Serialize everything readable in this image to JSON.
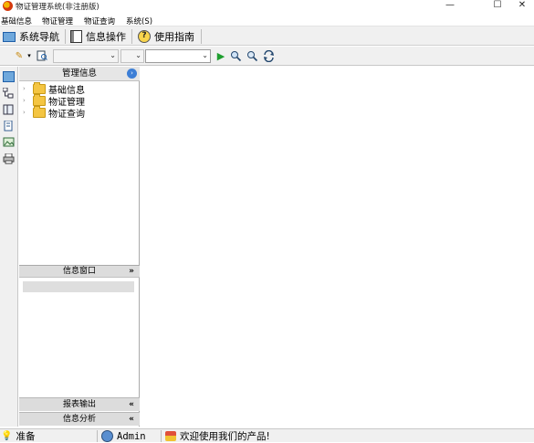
{
  "window": {
    "title": "物证管理系统(非注册版)",
    "controls": {
      "minimize": "—",
      "maximize": "☐",
      "close": "✕"
    }
  },
  "menu": [
    "基础信息",
    "物证管理",
    "物证查询",
    "系统(S)"
  ],
  "nav_toolbar": [
    {
      "label": "系统导航",
      "icon": "monitor-icon"
    },
    {
      "label": "信息操作",
      "icon": "book-icon"
    },
    {
      "label": "使用指南",
      "icon": "help-icon"
    }
  ],
  "toolbar2": {
    "combo1_value": "",
    "combo2_value": "",
    "combo3_value": ""
  },
  "tree_panel": {
    "header": "管理信息",
    "nodes": [
      "基础信息",
      "物证管理",
      "物证查询"
    ]
  },
  "info_panel": {
    "header": "信息窗口"
  },
  "footer_buttons": [
    "报表输出",
    "信息分析"
  ],
  "status": {
    "ready": "准备",
    "user": "Admin",
    "message": "欢迎使用我们的产品!"
  }
}
